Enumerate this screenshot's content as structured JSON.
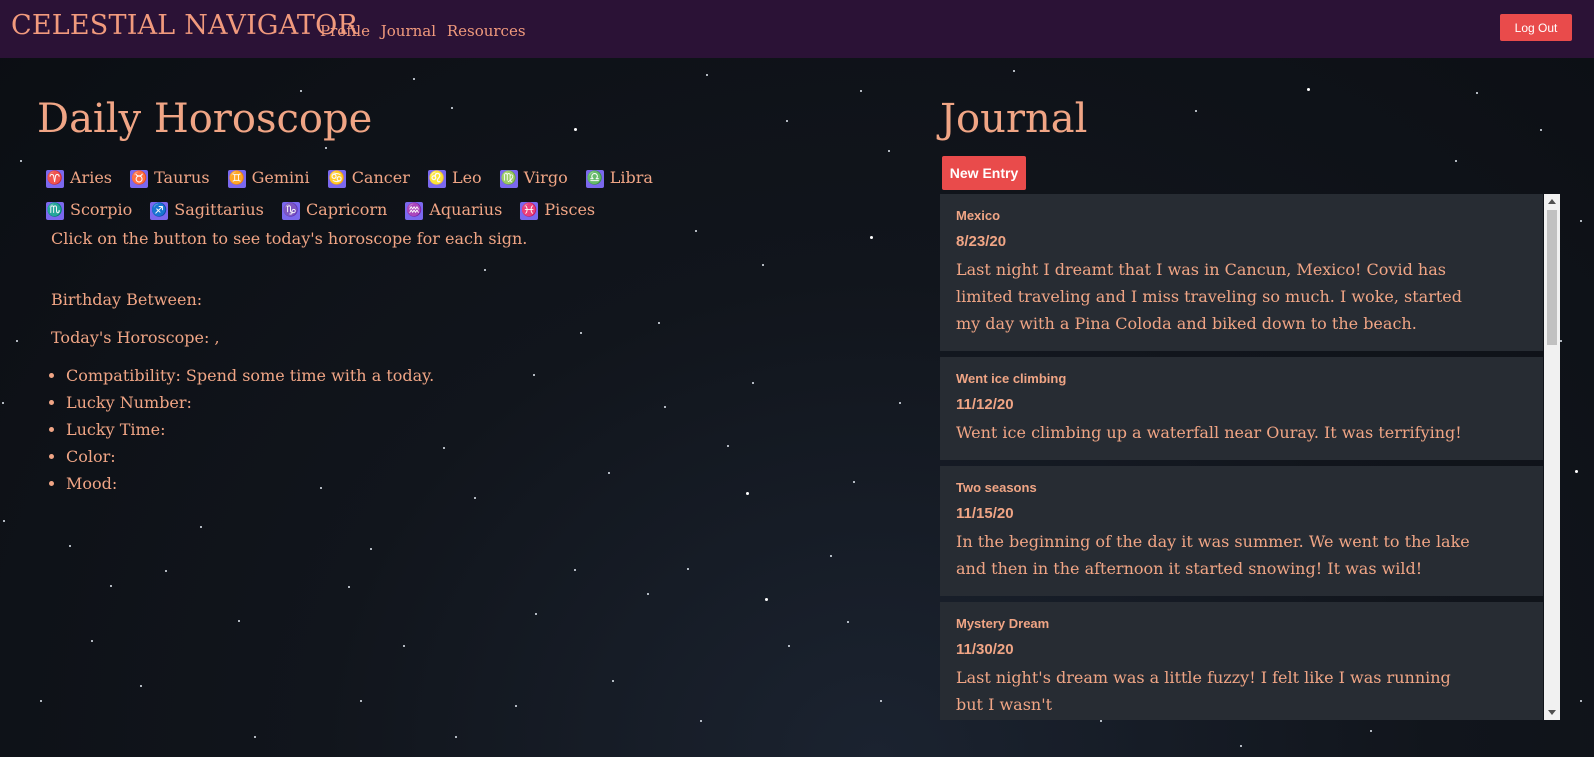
{
  "nav": {
    "brand": "CELESTIAL NAVIGATOR",
    "links": [
      "Profile",
      "Journal",
      "Resources"
    ],
    "logout": "Log Out"
  },
  "horoscope": {
    "title": "Daily Horoscope",
    "signs": [
      {
        "glyph": "♈",
        "name": "Aries"
      },
      {
        "glyph": "♉",
        "name": "Taurus"
      },
      {
        "glyph": "♊",
        "name": "Gemini"
      },
      {
        "glyph": "♋",
        "name": "Cancer"
      },
      {
        "glyph": "♌",
        "name": "Leo"
      },
      {
        "glyph": "♍",
        "name": "Virgo"
      },
      {
        "glyph": "♎",
        "name": "Libra"
      },
      {
        "glyph": "♏",
        "name": "Scorpio"
      },
      {
        "glyph": "♐",
        "name": "Sagittarius"
      },
      {
        "glyph": "♑",
        "name": "Capricorn"
      },
      {
        "glyph": "♒",
        "name": "Aquarius"
      },
      {
        "glyph": "♓",
        "name": "Pisces"
      }
    ],
    "hint": "Click on the button to see today's horoscope for each sign.",
    "birthday": "Birthday Between:",
    "today": "Today's Horoscope: ,",
    "details": [
      "Compatibility: Spend some time with a today.",
      "Lucky Number:",
      "Lucky Time:",
      "Color:",
      "Mood:"
    ]
  },
  "journal": {
    "title": "Journal",
    "new_entry": "New Entry",
    "entries": [
      {
        "title": "Mexico",
        "date": "8/23/20",
        "body": "Last night I dreamt that I was in Cancun, Mexico! Covid has limited traveling and I miss traveling so much. I woke, started my day with a Pina Coloda and biked down to the beach."
      },
      {
        "title": "Went ice climbing",
        "date": "11/12/20",
        "body": "Went ice climbing up a waterfall near Ouray. It was terrifying!"
      },
      {
        "title": "Two seasons",
        "date": "11/15/20",
        "body": "In the beginning of the day it was summer. We went to the lake and then in the afternoon it started snowing! It was wild!"
      },
      {
        "title": "Mystery Dream",
        "date": "11/30/20",
        "body": "Last night's dream was a little fuzzy! I felt like I was running but I wasn't"
      }
    ]
  },
  "colors": {
    "navbar": "#2b1236",
    "accent_text": "#f0a585",
    "button_red": "#e94b4b",
    "sign_chip": "#7b68ee",
    "entry_card": "#272c33"
  }
}
